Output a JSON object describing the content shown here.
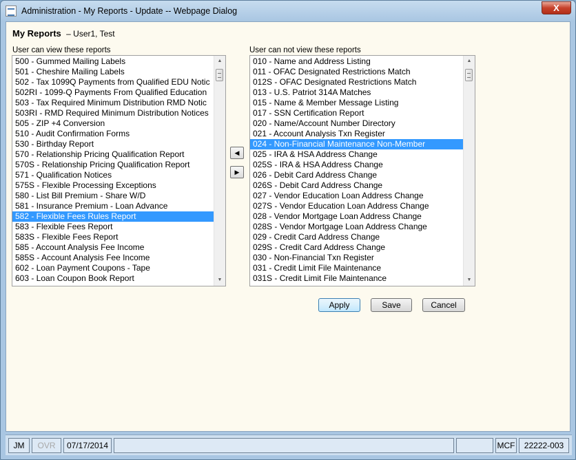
{
  "window": {
    "title": "Administration - My Reports - Update -- Webpage Dialog",
    "close_glyph": "X"
  },
  "header": {
    "title": "My Reports",
    "user": "– User1, Test"
  },
  "left_list": {
    "label": "User can view these reports",
    "items": [
      "500 - Gummed Mailing Labels",
      "501 - Cheshire Mailing Labels",
      "502 - Tax 1099Q Payments from Qualified EDU Notic",
      "502RI - 1099-Q Payments From Qualified Education",
      "503 - Tax Required Minimum Distribution RMD Notic",
      "503RI - RMD Required Minimum Distribution Notices",
      "505 - ZIP +4 Conversion",
      "510 - Audit Confirmation Forms",
      "530 - Birthday Report",
      "570 - Relationship Pricing Qualification Report",
      "570S - Relationship Pricing Qualification Report",
      "571 - Qualification Notices",
      "575S - Flexible Processing Exceptions",
      "580 - List Bill Premium - Share W/D",
      "581 - Insurance Premium - Loan Advance",
      "582 - Flexible Fees Rules Report",
      "583 - Flexible Fees Report",
      "583S - Flexible Fees Report",
      "585 - Account Analysis Fee Income",
      "585S - Account Analysis Fee Income",
      "602 - Loan Payment Coupons - Tape",
      "603 - Loan Coupon Book Report"
    ],
    "selected_index": 15
  },
  "right_list": {
    "label": "User can not view these reports",
    "items": [
      "010 - Name and Address Listing",
      "011 - OFAC Designated Restrictions Match",
      "012S - OFAC Designated Restrictions Match",
      "013 - U.S. Patriot 314A Matches",
      "015 - Name & Member Message Listing",
      "017 - SSN Certification Report",
      "020 - Name/Account Number Directory",
      "021 - Account Analysis Txn Register",
      "024 - Non-Financial Maintenance Non-Member",
      "025 - IRA & HSA Address Change",
      "025S - IRA & HSA Address Change",
      "026 - Debit Card Address Change",
      "026S - Debit Card Address Change",
      "027 - Vendor Education Loan Address Change",
      "027S - Vendor Education Loan Address Change",
      "028 - Vendor Mortgage Loan Address Change",
      "028S - Vendor Mortgage Loan Address Change",
      "029 - Credit Card Address Change",
      "029S - Credit Card Address Change",
      "030 - Non-Financial Txn Register",
      "031 - Credit Limit File Maintenance",
      "031S - Credit Limit File Maintenance"
    ],
    "selected_index": 8
  },
  "move_buttons": {
    "left_glyph": "◀",
    "right_glyph": "▶"
  },
  "scrollbar_glyphs": {
    "up": "▲",
    "down": "▼"
  },
  "actions": {
    "apply": "Apply",
    "save": "Save",
    "cancel": "Cancel"
  },
  "status": {
    "user": "JM",
    "ovr": "OVR",
    "date": "07/17/2014",
    "field_blank_1": "",
    "field_blank_2": "",
    "system": "MCF",
    "code": "22222-003"
  },
  "colors": {
    "selection": "#3399ff",
    "content_bg": "#fdfaef",
    "frame": "#a9c6e2",
    "close_button": "#c7422b"
  }
}
